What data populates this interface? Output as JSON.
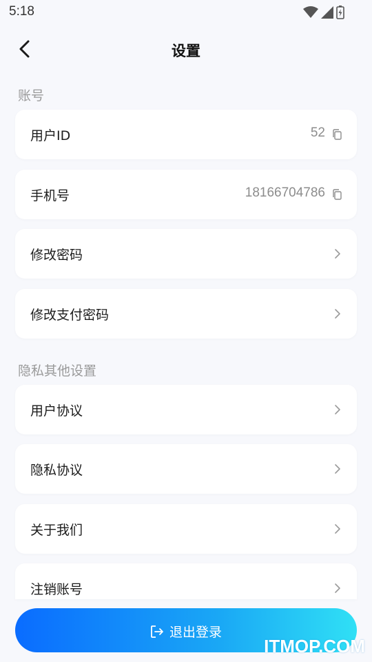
{
  "status_bar": {
    "time": "5:18"
  },
  "header": {
    "title": "设置"
  },
  "sections": {
    "account": {
      "title": "账号",
      "user_id": {
        "label": "用户ID",
        "value": "52"
      },
      "phone": {
        "label": "手机号",
        "value": "18166704786"
      },
      "change_password": {
        "label": "修改密码"
      },
      "change_pay_password": {
        "label": "修改支付密码"
      }
    },
    "privacy": {
      "title": "隐私其他设置",
      "user_agreement": {
        "label": "用户协议"
      },
      "privacy_policy": {
        "label": "隐私协议"
      },
      "about_us": {
        "label": "关于我们"
      },
      "delete_account": {
        "label": "注销账号"
      }
    }
  },
  "logout": {
    "label": "退出登录"
  },
  "watermark": "ITMOP.COM",
  "colors": {
    "background": "#f7f8fc",
    "card": "#ffffff",
    "section_title": "#9a9a9a",
    "gradient_start": "#0a6cff",
    "gradient_end": "#30e0f5"
  },
  "icons": {
    "back": "chevron-left-icon",
    "copy": "copy-icon",
    "chevron": "chevron-right-icon",
    "logout": "logout-icon"
  }
}
